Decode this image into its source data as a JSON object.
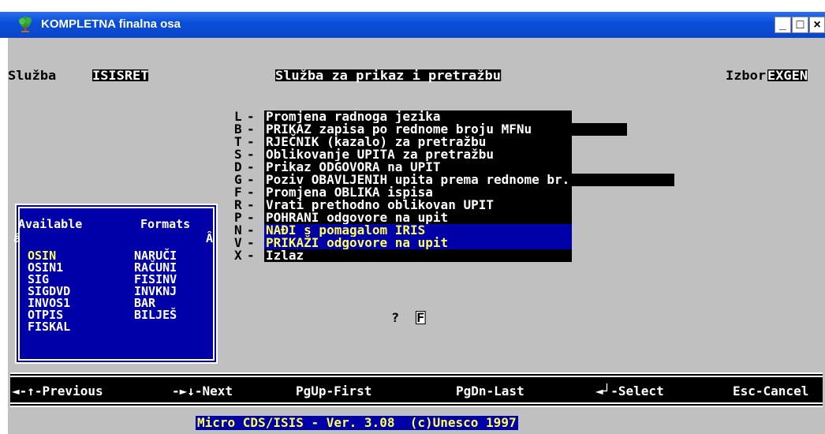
{
  "window": {
    "title": "KOMPLETNA finalna osa",
    "minimize_label": "_",
    "maximize_label": "□",
    "close_label": "×"
  },
  "header": {
    "sluzba_label": "Služba",
    "sluzba_value": "ISISRET",
    "service_title": "Služba za prikaz i pretražbu",
    "izbor_label": "Izbor",
    "izbor_value": "EXGEN"
  },
  "menu": [
    {
      "key": "L",
      "label": "Promjena radnoga jezika"
    },
    {
      "key": "B",
      "label": "PRIKAZ zapisa po rednome broju MFNu"
    },
    {
      "key": "T",
      "label": "RJEČNIK (kazalo) za pretražbu"
    },
    {
      "key": "S",
      "label": "Oblikovanje UPITA za pretražbu"
    },
    {
      "key": "D",
      "label": "Prikaz ODGOVORA na UPIT"
    },
    {
      "key": "G",
      "label": "Poziv OBAVLJENIH upita prema rednome br."
    },
    {
      "key": "F",
      "label": "Promjena OBLIKA ispisa"
    },
    {
      "key": "R",
      "label": "Vrati prethodno oblikovan UPIT"
    },
    {
      "key": "P",
      "label": "POHRANI odgovore na upit"
    },
    {
      "key": "N",
      "label": "NAĐI s pomagalom IRIS"
    },
    {
      "key": "V",
      "label": "PRIKAŽI odgovore na upit"
    },
    {
      "key": "X",
      "label": "Izlaz"
    }
  ],
  "menu_dash": "-",
  "prompt": {
    "question": "?",
    "input_value": "F"
  },
  "formats_panel": {
    "title_left": "Available",
    "title_right": "Formats",
    "scroll_left": "ă",
    "scroll_right": "Â",
    "col1": [
      "OSIN",
      "OSIN1",
      "SIG",
      "SIGDVD",
      "INVOS1",
      "OTPIS",
      "FISKAL"
    ],
    "col2": [
      "NARUČI",
      "RAČUNI",
      "FISINV",
      "INVKNJ",
      "BAR",
      "BILJEŠ"
    ]
  },
  "nav_bar": {
    "previous": "◄-↑-Previous",
    "next": "-►↓-Next",
    "pgup": "PgUp-First",
    "pgdn": "PgDn-Last",
    "select": "◄┘-Select",
    "cancel": "Esc-Cancel"
  },
  "footer": "Micro CDS/ISIS - Ver. 3.08  (c)Unesco 1997",
  "colors": {
    "title_bar": "#0a4fd8",
    "dos_bg": "#c0c0c0",
    "panel_blue": "#0000a8",
    "highlight_yellow": "#ffff55"
  }
}
